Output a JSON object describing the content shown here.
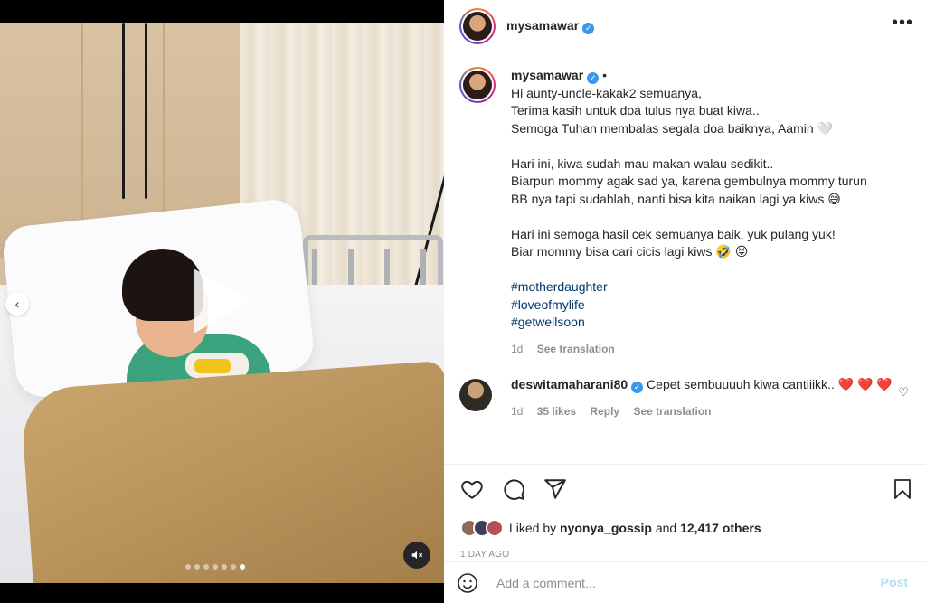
{
  "post": {
    "username": "mysamawar",
    "more_label": "•••",
    "caption_lines": [
      "Hi aunty-uncle-kakak2 semuanya,",
      "Terima kasih untuk doa tulus nya buat kiwa..",
      "Semoga Tuhan membalas segala doa baiknya, Aamin 🤍",
      "",
      "Hari ini, kiwa sudah mau makan walau sedikit..",
      "Biarpun mommy agak sad ya, karena gembulnya mommy turun",
      "BB nya tapi sudahlah, nanti bisa kita naikan lagi ya kiws 😅",
      "",
      "Hari ini semoga hasil cek semuanya baik, yuk pulang yuk!",
      "Biar mommy bisa cari cicis lagi kiws 🤣 😝"
    ],
    "hashtags": [
      "#motherdaughter",
      "#loveofmylife",
      "#getwellsoon"
    ],
    "caption_time": "1d",
    "see_translation": "See translation",
    "dot_separator": "•"
  },
  "comment": {
    "username": "deswitamaharani80",
    "text": "Cepet sembuuuuh kiwa cantiiikk..",
    "hearts": "❤️ ❤️ ❤️",
    "time": "1d",
    "likes": "35 likes",
    "reply": "Reply",
    "see_translation": "See translation"
  },
  "likes": {
    "prefix": "Liked by",
    "user": "nyonya_gossip",
    "and": "and",
    "others": "12,417 others"
  },
  "time_ago": "1 DAY AGO",
  "add_comment": {
    "placeholder": "Add a comment...",
    "post_label": "Post"
  },
  "carousel": {
    "slide_count": 7,
    "active_slide": 7
  },
  "colors": {
    "link": "#00376b",
    "verified": "#3897f0",
    "heart": "#ed4956",
    "post_disabled": "#b2dffc"
  }
}
